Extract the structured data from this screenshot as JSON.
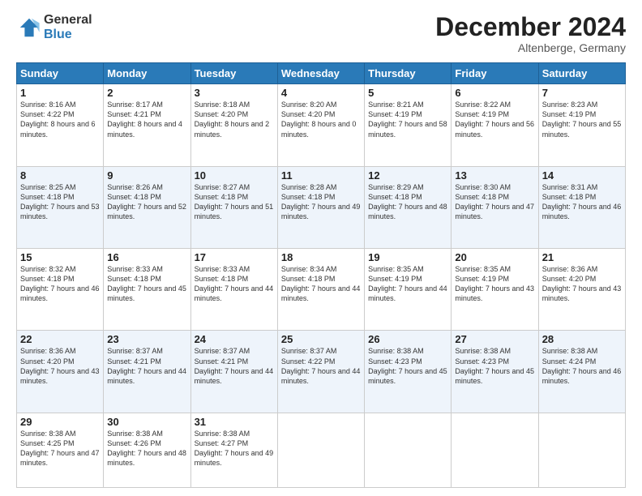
{
  "logo": {
    "general": "General",
    "blue": "Blue"
  },
  "header": {
    "month": "December 2024",
    "location": "Altenberge, Germany"
  },
  "weekdays": [
    "Sunday",
    "Monday",
    "Tuesday",
    "Wednesday",
    "Thursday",
    "Friday",
    "Saturday"
  ],
  "weeks": [
    [
      {
        "day": "1",
        "sunrise": "8:16 AM",
        "sunset": "4:22 PM",
        "daylight": "8 hours and 6 minutes."
      },
      {
        "day": "2",
        "sunrise": "8:17 AM",
        "sunset": "4:21 PM",
        "daylight": "8 hours and 4 minutes."
      },
      {
        "day": "3",
        "sunrise": "8:18 AM",
        "sunset": "4:20 PM",
        "daylight": "8 hours and 2 minutes."
      },
      {
        "day": "4",
        "sunrise": "8:20 AM",
        "sunset": "4:20 PM",
        "daylight": "8 hours and 0 minutes."
      },
      {
        "day": "5",
        "sunrise": "8:21 AM",
        "sunset": "4:19 PM",
        "daylight": "7 hours and 58 minutes."
      },
      {
        "day": "6",
        "sunrise": "8:22 AM",
        "sunset": "4:19 PM",
        "daylight": "7 hours and 56 minutes."
      },
      {
        "day": "7",
        "sunrise": "8:23 AM",
        "sunset": "4:19 PM",
        "daylight": "7 hours and 55 minutes."
      }
    ],
    [
      {
        "day": "8",
        "sunrise": "8:25 AM",
        "sunset": "4:18 PM",
        "daylight": "7 hours and 53 minutes."
      },
      {
        "day": "9",
        "sunrise": "8:26 AM",
        "sunset": "4:18 PM",
        "daylight": "7 hours and 52 minutes."
      },
      {
        "day": "10",
        "sunrise": "8:27 AM",
        "sunset": "4:18 PM",
        "daylight": "7 hours and 51 minutes."
      },
      {
        "day": "11",
        "sunrise": "8:28 AM",
        "sunset": "4:18 PM",
        "daylight": "7 hours and 49 minutes."
      },
      {
        "day": "12",
        "sunrise": "8:29 AM",
        "sunset": "4:18 PM",
        "daylight": "7 hours and 48 minutes."
      },
      {
        "day": "13",
        "sunrise": "8:30 AM",
        "sunset": "4:18 PM",
        "daylight": "7 hours and 47 minutes."
      },
      {
        "day": "14",
        "sunrise": "8:31 AM",
        "sunset": "4:18 PM",
        "daylight": "7 hours and 46 minutes."
      }
    ],
    [
      {
        "day": "15",
        "sunrise": "8:32 AM",
        "sunset": "4:18 PM",
        "daylight": "7 hours and 46 minutes."
      },
      {
        "day": "16",
        "sunrise": "8:33 AM",
        "sunset": "4:18 PM",
        "daylight": "7 hours and 45 minutes."
      },
      {
        "day": "17",
        "sunrise": "8:33 AM",
        "sunset": "4:18 PM",
        "daylight": "7 hours and 44 minutes."
      },
      {
        "day": "18",
        "sunrise": "8:34 AM",
        "sunset": "4:18 PM",
        "daylight": "7 hours and 44 minutes."
      },
      {
        "day": "19",
        "sunrise": "8:35 AM",
        "sunset": "4:19 PM",
        "daylight": "7 hours and 44 minutes."
      },
      {
        "day": "20",
        "sunrise": "8:35 AM",
        "sunset": "4:19 PM",
        "daylight": "7 hours and 43 minutes."
      },
      {
        "day": "21",
        "sunrise": "8:36 AM",
        "sunset": "4:20 PM",
        "daylight": "7 hours and 43 minutes."
      }
    ],
    [
      {
        "day": "22",
        "sunrise": "8:36 AM",
        "sunset": "4:20 PM",
        "daylight": "7 hours and 43 minutes."
      },
      {
        "day": "23",
        "sunrise": "8:37 AM",
        "sunset": "4:21 PM",
        "daylight": "7 hours and 44 minutes."
      },
      {
        "day": "24",
        "sunrise": "8:37 AM",
        "sunset": "4:21 PM",
        "daylight": "7 hours and 44 minutes."
      },
      {
        "day": "25",
        "sunrise": "8:37 AM",
        "sunset": "4:22 PM",
        "daylight": "7 hours and 44 minutes."
      },
      {
        "day": "26",
        "sunrise": "8:38 AM",
        "sunset": "4:23 PM",
        "daylight": "7 hours and 45 minutes."
      },
      {
        "day": "27",
        "sunrise": "8:38 AM",
        "sunset": "4:23 PM",
        "daylight": "7 hours and 45 minutes."
      },
      {
        "day": "28",
        "sunrise": "8:38 AM",
        "sunset": "4:24 PM",
        "daylight": "7 hours and 46 minutes."
      }
    ],
    [
      {
        "day": "29",
        "sunrise": "8:38 AM",
        "sunset": "4:25 PM",
        "daylight": "7 hours and 47 minutes."
      },
      {
        "day": "30",
        "sunrise": "8:38 AM",
        "sunset": "4:26 PM",
        "daylight": "7 hours and 48 minutes."
      },
      {
        "day": "31",
        "sunrise": "8:38 AM",
        "sunset": "4:27 PM",
        "daylight": "7 hours and 49 minutes."
      },
      null,
      null,
      null,
      null
    ]
  ],
  "labels": {
    "sunrise": "Sunrise:",
    "sunset": "Sunset:",
    "daylight": "Daylight:"
  }
}
